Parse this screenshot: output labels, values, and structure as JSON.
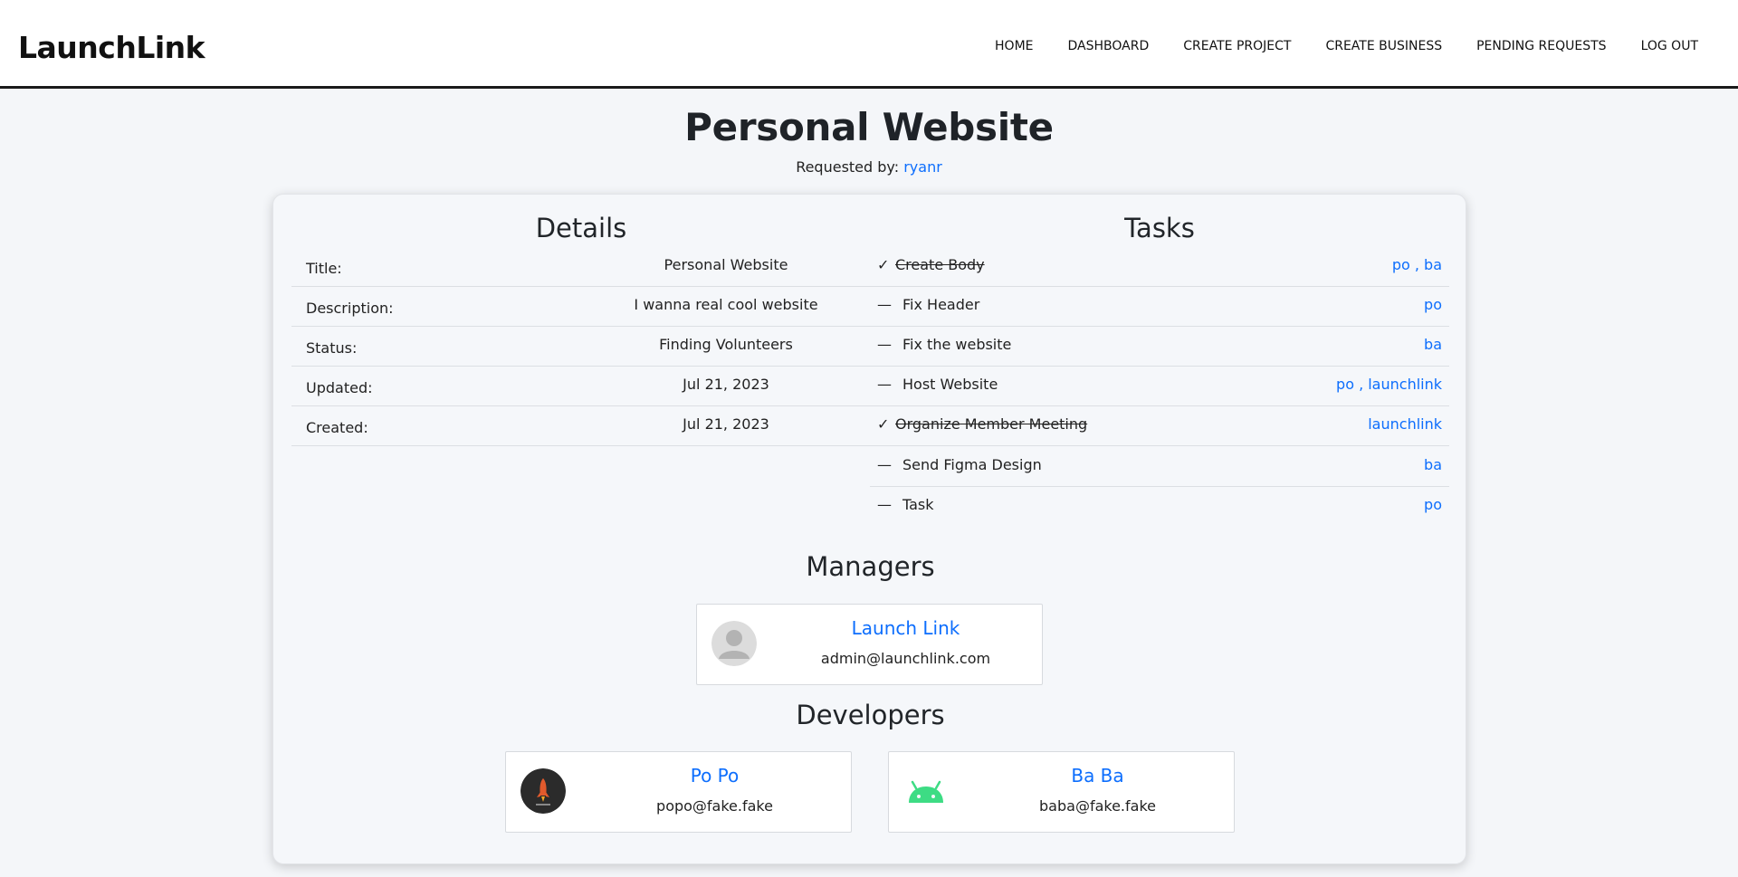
{
  "nav": {
    "brand": "LaunchLink",
    "items": [
      "HOME",
      "DASHBOARD",
      "CREATE PROJECT",
      "CREATE BUSINESS",
      "PENDING REQUESTS",
      "LOG OUT"
    ]
  },
  "project": {
    "title": "Personal Website",
    "requested_label": "Requested by:",
    "requested_by": "ryanr"
  },
  "details": {
    "heading": "Details",
    "rows": [
      {
        "label": "Title:",
        "value": "Personal Website"
      },
      {
        "label": "Description:",
        "value": "I wanna real cool website"
      },
      {
        "label": "Status:",
        "value": "Finding Volunteers"
      },
      {
        "label": "Updated:",
        "value": "Jul 21, 2023"
      },
      {
        "label": "Created:",
        "value": "Jul 21, 2023"
      }
    ]
  },
  "tasks": {
    "heading": "Tasks",
    "items": [
      {
        "name": "Create Body",
        "done": true,
        "mark": "✓",
        "assignees": "po , ba"
      },
      {
        "name": "Fix Header",
        "done": false,
        "mark": "—",
        "assignees": "po"
      },
      {
        "name": "Fix the website",
        "done": false,
        "mark": "—",
        "assignees": "ba"
      },
      {
        "name": "Host Website",
        "done": false,
        "mark": "—",
        "assignees": "po , launchlink"
      },
      {
        "name": "Organize Member Meeting",
        "done": true,
        "mark": "✓",
        "assignees": "launchlink"
      },
      {
        "name": "Send Figma Design",
        "done": false,
        "mark": "—",
        "assignees": "ba"
      },
      {
        "name": "Task",
        "done": false,
        "mark": "—",
        "assignees": "po"
      }
    ]
  },
  "managers": {
    "heading": "Managers",
    "people": [
      {
        "name": "Launch Link",
        "email": "admin@launchlink.com",
        "avatar": "default-user-icon"
      }
    ]
  },
  "developers": {
    "heading": "Developers",
    "people": [
      {
        "name": "Po Po",
        "email": "popo@fake.fake",
        "avatar": "rocket-logo-icon"
      },
      {
        "name": "Ba Ba",
        "email": "baba@fake.fake",
        "avatar": "android-icon"
      }
    ]
  },
  "colors": {
    "accent": "#0d6efd",
    "background": "#f4f6f9",
    "android_green": "#3ddc84"
  }
}
